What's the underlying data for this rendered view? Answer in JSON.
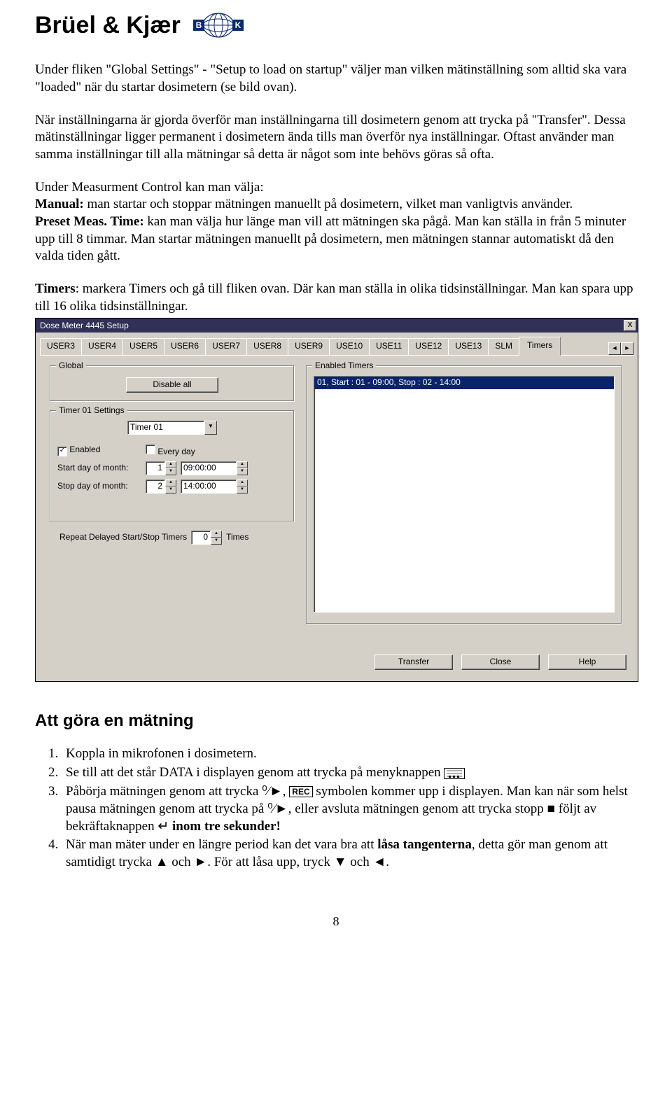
{
  "logo": {
    "brand": "Brüel & Kjær",
    "b": "B",
    "k": "K"
  },
  "p1": "Under fliken \"Global Settings\" - \"Setup to load on startup\" väljer man vilken mätinställning som alltid ska vara \"loaded\" när du startar dosimetern (se bild ovan).",
  "p2": "När inställningarna är gjorda överför man inställningarna till dosimetern genom att trycka på \"Transfer\". Dessa mätinställningar ligger permanent i dosimetern ända tills man överför nya inställningar. Oftast använder man samma inställningar till alla mätningar så detta är något som inte behövs göras så ofta.",
  "p3a": "Under Measurment Control kan man välja:",
  "p3b_label": "Manual:",
  "p3b": " man startar och stoppar mätningen manuellt på dosimetern, vilket man vanligtvis använder.",
  "p3c_label": "Preset Meas. Time:",
  "p3c": " kan man välja hur länge man vill att mätningen ska pågå. Man kan ställa in från 5 minuter upp till 8 timmar. Man startar mätningen manuellt på dosimetern, men mätningen stannar automatiskt då den valda tiden gått.",
  "p4_label": "Timers",
  "p4": ": markera Timers och gå till fliken ovan. Där kan man ställa in olika tidsinställningar. Man kan spara upp till 16 olika tidsinställningar.",
  "dialog": {
    "title": "Dose Meter 4445 Setup",
    "tabs": [
      "USER3",
      "USER4",
      "USER5",
      "USER6",
      "USER7",
      "USER8",
      "USER9",
      "USE10",
      "USE11",
      "USE12",
      "USE13",
      "SLM",
      "Timers"
    ],
    "active_tab": "Timers",
    "nav_left": "◄",
    "nav_right": "►",
    "close_x": "X",
    "global": {
      "title": "Global",
      "btn": "Disable all"
    },
    "timer": {
      "title": "Timer 01 Settings",
      "combo": "Timer 01",
      "enabled_label": "Enabled",
      "everyday_label": "Every day",
      "start_label": "Start day of month:",
      "start_val": "1",
      "start_time": "09:00:00",
      "stop_label": "Stop day of month:",
      "stop_val": "2",
      "stop_time": "14:00:00"
    },
    "repeat": {
      "label": "Repeat Delayed Start/Stop Timers",
      "val": "0",
      "suffix": "Times"
    },
    "enabled": {
      "title": "Enabled Timers",
      "item": "01, Start : 01 - 09:00, Stop : 02 - 14:00"
    },
    "buttons": {
      "transfer": "Transfer",
      "close": "Close",
      "help": "Help"
    }
  },
  "section2": "Att göra en mätning",
  "steps": {
    "s1": "Koppla in mikrofonen i dosimetern.",
    "s2": "Se till att det står DATA i displayen genom att trycka på menyknappen ",
    "s3a": "Påbörja mätningen genom att trycka ",
    "s3_pp": "⁰⁄►",
    "s3b": ", ",
    "s3_rec": "REC",
    "s3c": " symbolen kommer upp i displayen. Man kan när som helst pausa mätningen genom att trycka på ",
    "s3d": ", eller avsluta mätningen genom att trycka stopp ",
    "s3_stop": "■",
    "s3e": " följt av bekräftaknappen ↵ ",
    "s3f": "inom tre sekunder!",
    "s4a": "När man mäter under en längre period kan det vara bra att ",
    "s4b": "låsa tangenterna",
    "s4c": ", detta gör man genom att samtidigt trycka ▲ och ►. För att låsa upp, tryck ▼ och ◄."
  },
  "page": "8"
}
